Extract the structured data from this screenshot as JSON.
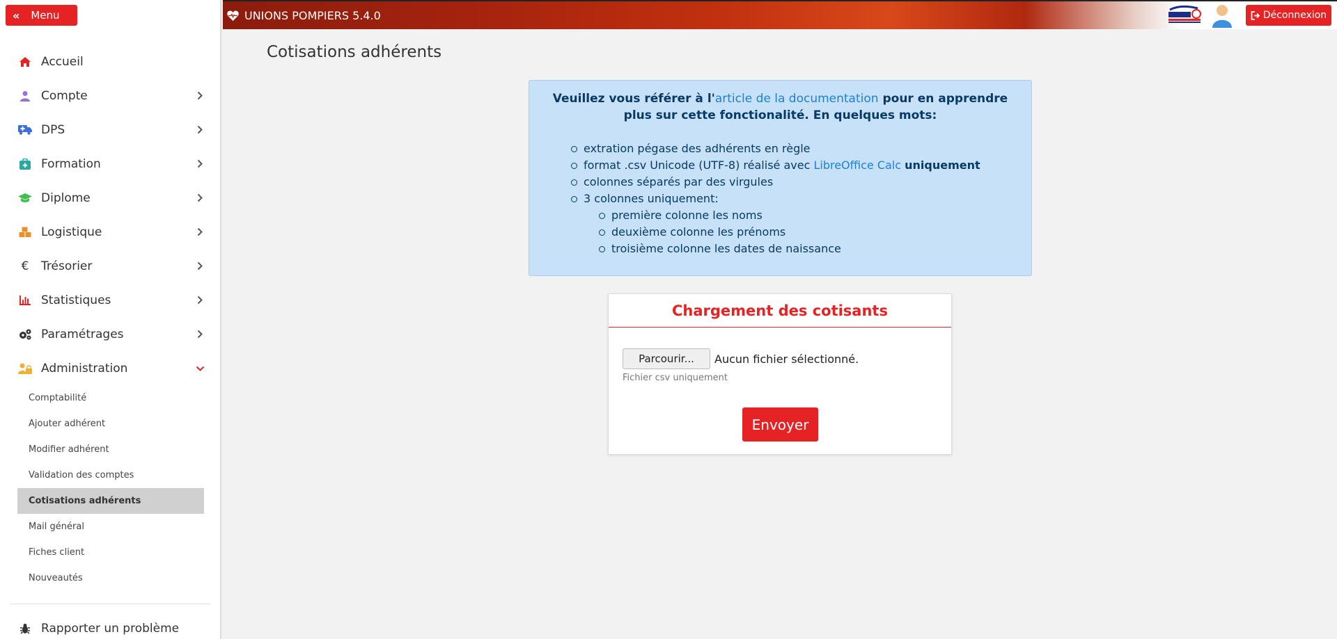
{
  "app": {
    "brand": "UNIONS POMPIERS 5.4.0",
    "menu_label": "Menu",
    "logout_label": "Déconnexion"
  },
  "sidebar": {
    "items": [
      {
        "label": "Accueil",
        "icon": "home-icon",
        "color": "#e52325"
      },
      {
        "label": "Compte",
        "icon": "user-icon",
        "color": "#9a6fd6"
      },
      {
        "label": "DPS",
        "icon": "ambulance-icon",
        "color": "#3f6fd6"
      },
      {
        "label": "Formation",
        "icon": "medkit-icon",
        "color": "#27a8a0"
      },
      {
        "label": "Diplome",
        "icon": "graduation-cap-icon",
        "color": "#3fbf50"
      },
      {
        "label": "Logistique",
        "icon": "cubes-icon",
        "color": "#e8902a"
      },
      {
        "label": "Trésorier",
        "icon": "euro-icon",
        "color": "#333333"
      },
      {
        "label": "Statistiques",
        "icon": "bar-chart-icon",
        "color": "#e52325"
      },
      {
        "label": "Paramétrages",
        "icon": "cogs-icon",
        "color": "#333333"
      },
      {
        "label": "Administration",
        "icon": "user-lock-icon",
        "color": "#f0b030"
      }
    ],
    "sub_items": [
      {
        "label": "Comptabilité"
      },
      {
        "label": "Ajouter adhérent"
      },
      {
        "label": "Modifier adhérent"
      },
      {
        "label": "Validation des comptes"
      },
      {
        "label": "Cotisations adhérents"
      },
      {
        "label": "Mail général"
      },
      {
        "label": "Fiches client"
      },
      {
        "label": "Nouveautés"
      }
    ],
    "report_label": "Rapporter un problème"
  },
  "main": {
    "title": "Cotisations adhérents",
    "info": {
      "intro_prefix": "Veuillez vous référer à l'",
      "doc_link": "article de la documentation",
      "intro_suffix": " pour en apprendre plus sur cette fonctionalité. En quelques mots:",
      "items": [
        "extration pégase des adhérents en règle",
        "colonnes séparés par des virgules",
        "3 colonnes uniquement:"
      ],
      "csv_prefix": "format .csv Unicode (UTF-8) réalisé avec ",
      "csv_link": "LibreOffice Calc",
      "csv_bold": "uniquement",
      "columns": [
        "première colonne les noms",
        "deuxième colonne les prénoms",
        "troisième colonne les dates de naissance"
      ]
    },
    "upload": {
      "title": "Chargement des cotisants",
      "browse_label": "Parcourir...",
      "file_status": "Aucun fichier sélectionné.",
      "help": "Fichier csv uniquement",
      "submit_label": "Envoyer"
    }
  },
  "colors": {
    "accent": "#e52325",
    "info_bg": "#c7e1f8",
    "link": "#1e80d6"
  }
}
